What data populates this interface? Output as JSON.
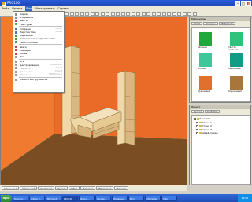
{
  "window": {
    "title": "PRO100"
  },
  "menubar": [
    "Файл",
    "Правка",
    "Вид",
    "Инструменты",
    "Справка"
  ],
  "dropdown": {
    "items": [
      {
        "label": "Каркас",
        "icon_color": "#8a8a8a",
        "enabled": true
      },
      {
        "label": "Избранное",
        "icon_color": "#8a8a8a",
        "enabled": true
      },
      {
        "label": "Цвета",
        "icon_color": "#c43b3b",
        "enabled": true
      },
      {
        "label": "Текстуры",
        "icon_color": "#4aa84a",
        "enabled": true
      },
      {
        "sep": true
      },
      {
        "label": "Спереди",
        "shortcut": "Ctrl+1",
        "icon_color": "#3f6fc8",
        "enabled": true
      },
      {
        "label": "Перспектива",
        "shortcut": "Ctrl+2",
        "icon_color": "#3f6fc8",
        "enabled": true
      },
      {
        "label": "Каркасная",
        "icon_color": "#3f9a3f",
        "enabled": true
      },
      {
        "label": "Освещенная с отражениями",
        "icon_color": "#3f9a3f",
        "enabled": true
      },
      {
        "label": "Тени с полами",
        "icon_color": "#3f9a3f",
        "enabled": true
      },
      {
        "sep": true
      },
      {
        "label": "Шаги",
        "icon_color": "#c43b3b",
        "enabled": true
      },
      {
        "label": "Размеры",
        "icon_color": "#c43b3b",
        "enabled": true
      },
      {
        "label": "Сетка",
        "icon_color": "#c43b3b",
        "enabled": true
      },
      {
        "label": "Фон",
        "icon_color": "#9a9a9a",
        "enabled": true
      },
      {
        "sep": true
      },
      {
        "label": "Всё",
        "icon_color": "#9a9a9a",
        "enabled": true
      },
      {
        "label": "Центрирование",
        "shortcut": "Shift+Ctrl+C",
        "icon_color": "#9a9a9a",
        "enabled": true
      },
      {
        "label": "Увеличить",
        "shortcut": "Ctrl+P",
        "icon_color": "#9a9a9a",
        "enabled": false
      },
      {
        "label": "Уменьшить",
        "shortcut": "Ctrl+M",
        "icon_color": "#9a9a9a",
        "enabled": false
      },
      {
        "label": "Обзор",
        "shortcut": "Shift+Ctrl+O",
        "icon_color": "#9a9a9a",
        "enabled": false
      },
      {
        "sep": true
      },
      {
        "label": "Панели инструментов",
        "icon_color": "#9a9a9a",
        "enabled": true
      }
    ]
  },
  "scene_tabs": [
    "Спальня 1",
    "Спальня 2",
    "Гостиная",
    "Кухня",
    "Офис",
    "Детская",
    "Прихожая",
    "Ванная"
  ],
  "materials_panel": {
    "title": "Материалы",
    "tabs": [
      "Цвета",
      "Текстуры",
      "Избранное"
    ],
    "swatches": [
      {
        "label": "Зелёный",
        "color": "#1fa83c"
      },
      {
        "label": "Светло-зелёный",
        "color": "#2ec27a"
      },
      {
        "label": "Мятный",
        "color": "#3ec79a"
      },
      {
        "label": "Бирюзовый",
        "color": "#119c86"
      },
      {
        "label": "Оранжевый",
        "color": "#e0702e"
      },
      {
        "label": "Коричневый",
        "color": "#a8763a"
      }
    ]
  },
  "tree_panel": {
    "title": "Проект",
    "tabs": [
      "Проект",
      "Свойства"
    ],
    "rows": [
      "Комната",
      "Стена 1",
      "Стена 2",
      "Стена 3",
      "Шкаф-пенал"
    ]
  },
  "taskbar": {
    "start": "пуск",
    "buttons": [
      "Total Co...",
      "Adobe P...",
      "Microsof...",
      "PRO100",
      "Ozone...",
      "Yandex...",
      "Проводн...",
      "Paint",
      "IrfanView",
      "Calc"
    ],
    "clock": "12:00"
  },
  "colors": {
    "wall_back": "#ea6a27",
    "wall_side": "#f07a30",
    "floor": "#7a4e22",
    "wood": "#e6c998"
  }
}
